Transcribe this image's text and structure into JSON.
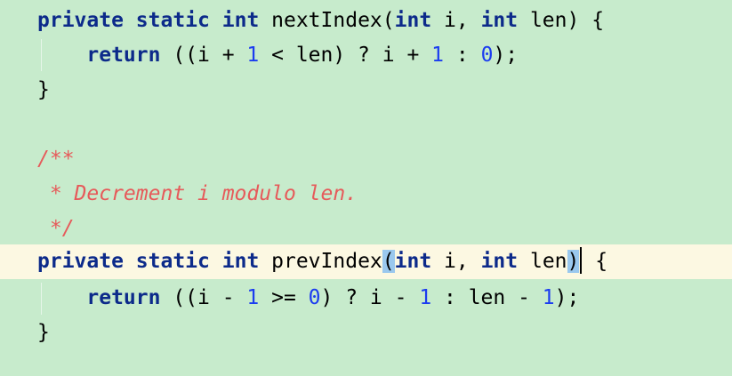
{
  "editor": {
    "colors": {
      "background": "#c7ebcc",
      "current_line": "#fcf8e2",
      "keyword": "#0c2a8a",
      "number": "#1b3cf0",
      "comment": "#e65a5a",
      "brace_match": "#9ac8ee"
    },
    "line1": {
      "kw1": "private",
      "sp1": " ",
      "kw2": "static",
      "sp2": " ",
      "kw3": "int",
      "t1": " nextIndex(",
      "kw4": "int",
      "t2": " i, ",
      "kw5": "int",
      "t3": " len) {"
    },
    "line2": {
      "indent": "    ",
      "kw1": "return",
      "t1": " ((i + ",
      "n1": "1",
      "t2": " < len) ? i + ",
      "n2": "1",
      "t3": " : ",
      "n3": "0",
      "t4": ");"
    },
    "line3": {
      "t1": "}"
    },
    "line5": {
      "c": "/**"
    },
    "line6": {
      "c": " * Decrement i modulo len."
    },
    "line7": {
      "c": " */"
    },
    "line8": {
      "kw1": "private",
      "sp1": " ",
      "kw2": "static",
      "sp2": " ",
      "kw3": "int",
      "t1": " prevIndex",
      "lparen": "(",
      "kw4": "int",
      "t2": " i, ",
      "kw5": "int",
      "t3": " len",
      "rparen": ")",
      "t4": " {"
    },
    "line9": {
      "indent": "    ",
      "kw1": "return",
      "t1": " ((i - ",
      "n1": "1",
      "t2": " >= ",
      "n2": "0",
      "t3": ") ? i - ",
      "n3": "1",
      "t4": " : len - ",
      "n4": "1",
      "t5": ");"
    },
    "line10": {
      "t1": "}"
    }
  }
}
